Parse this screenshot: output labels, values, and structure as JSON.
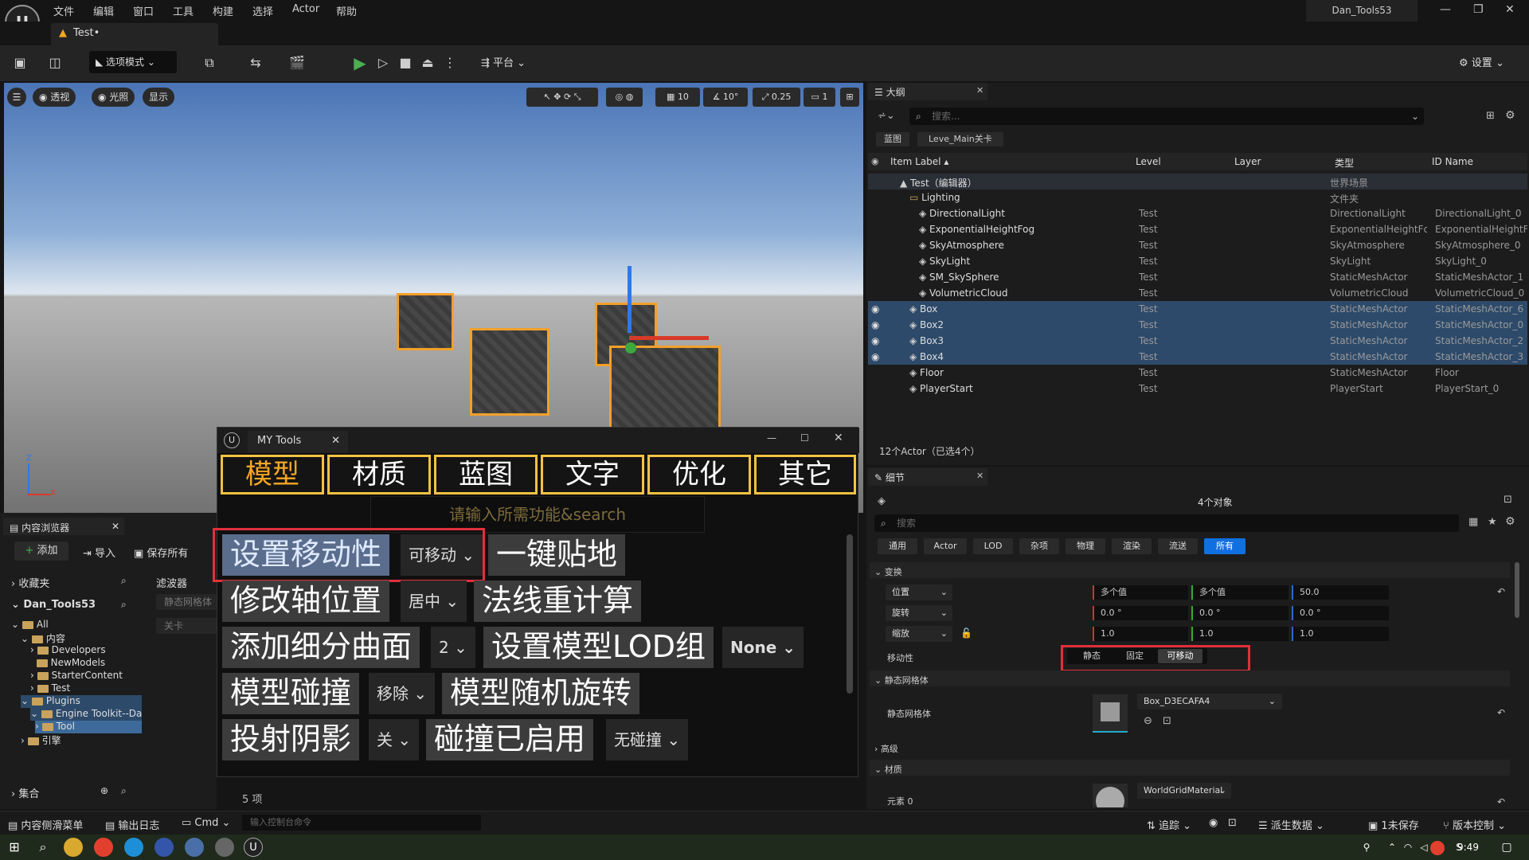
{
  "menubar": {
    "items": [
      "文件",
      "编辑",
      "窗口",
      "工具",
      "构建",
      "选择",
      "Actor",
      "帮助"
    ],
    "project_title": "Dan_Tools53",
    "logo_text": "U"
  },
  "level_tab": {
    "label": "Test•"
  },
  "toolbar": {
    "mode_label": "选项模式",
    "platform_label": "平台",
    "settings_label": "设置"
  },
  "viewport": {
    "pills": [
      "透视",
      "光照",
      "显示"
    ],
    "grid_snap": "10",
    "rotation_snap": "10°",
    "scale_snap": "0.25",
    "camera_speed": "1",
    "axis_z": "Z",
    "axis_x": "X"
  },
  "mytools": {
    "window_title": "MY Tools",
    "categories": [
      "模型",
      "材质",
      "蓝图",
      "文字",
      "优化",
      "其它"
    ],
    "search_placeholder": "请输入所需功能&search",
    "buttons": {
      "set_mobility": "设置移动性",
      "mobility_value": "可移动",
      "snap_ground": "一键贴地",
      "pivot": "修改轴位置",
      "pivot_value": "居中",
      "normals": "法线重计算",
      "subdiv": "添加细分曲面",
      "subdiv_value": "2",
      "lod_group": "设置模型LOD组",
      "lod_value": "None",
      "collision": "模型碰撞",
      "collision_value": "移除",
      "random_rot": "模型随机旋转",
      "shadow": "投射阴影",
      "shadow_value": "关",
      "collision_enabled": "碰撞已启用",
      "collision_enabled_value": "无碰撞"
    },
    "item_count": "5 项"
  },
  "content_browser": {
    "tab": "内容浏览器",
    "add": "添加",
    "import": "导入",
    "save_all": "保存所有",
    "favorites": "收藏夹",
    "project": "Dan_Tools53",
    "filters": "滤波器",
    "filter_items": [
      "静态网格体",
      "关卡"
    ],
    "tree": [
      "All",
      "内容",
      "Developers",
      "NewModels",
      "StarterContent",
      "Test",
      "Plugins",
      "Engine Toolkit--Dan",
      "Tool",
      "引擎"
    ],
    "collections": "集合"
  },
  "outliner": {
    "tab": "大纲",
    "search_placeholder": "搜索...",
    "chips": [
      "蓝图",
      "Leve_Main关卡"
    ],
    "headers": [
      "Item Label",
      "Level",
      "Layer",
      "类型",
      "ID Name"
    ],
    "rows": [
      {
        "label": "Test（编辑器）",
        "level": "",
        "type": "世界场景",
        "id": ""
      },
      {
        "label": "Lighting",
        "level": "",
        "type": "文件夹",
        "id": ""
      },
      {
        "label": "DirectionalLight",
        "level": "Test",
        "type": "DirectionalLight",
        "id": "DirectionalLight_0"
      },
      {
        "label": "ExponentialHeightFog",
        "level": "Test",
        "type": "ExponentialHeightFc",
        "id": "ExponentialHeightFc"
      },
      {
        "label": "SkyAtmosphere",
        "level": "Test",
        "type": "SkyAtmosphere",
        "id": "SkyAtmosphere_0"
      },
      {
        "label": "SkyLight",
        "level": "Test",
        "type": "SkyLight",
        "id": "SkyLight_0"
      },
      {
        "label": "SM_SkySphere",
        "level": "Test",
        "type": "StaticMeshActor",
        "id": "StaticMeshActor_1"
      },
      {
        "label": "VolumetricCloud",
        "level": "Test",
        "type": "VolumetricCloud",
        "id": "VolumetricCloud_0"
      },
      {
        "label": "Box",
        "level": "Test",
        "type": "StaticMeshActor",
        "id": "StaticMeshActor_6"
      },
      {
        "label": "Box2",
        "level": "Test",
        "type": "StaticMeshActor",
        "id": "StaticMeshActor_0"
      },
      {
        "label": "Box3",
        "level": "Test",
        "type": "StaticMeshActor",
        "id": "StaticMeshActor_2"
      },
      {
        "label": "Box4",
        "level": "Test",
        "type": "StaticMeshActor",
        "id": "StaticMeshActor_3"
      },
      {
        "label": "Floor",
        "level": "Test",
        "type": "StaticMeshActor",
        "id": "Floor"
      },
      {
        "label": "PlayerStart",
        "level": "Test",
        "type": "PlayerStart",
        "id": "PlayerStart_0"
      }
    ],
    "footer": "12个Actor（已选4个）"
  },
  "details": {
    "tab": "细节",
    "object_count": "4个对象",
    "search_placeholder": "搜索",
    "filter_tabs": [
      "通用",
      "Actor",
      "LOD",
      "杂项",
      "物理",
      "渲染",
      "流送",
      "所有"
    ],
    "transform_header": "变换",
    "location_label": "位置",
    "location": [
      "多个值",
      "多个值",
      "50.0"
    ],
    "rotation_label": "旋转",
    "rotation": [
      "0.0 °",
      "0.0 °",
      "0.0 °"
    ],
    "scale_label": "缩放",
    "scale": [
      "1.0",
      "1.0",
      "1.0"
    ],
    "mobility_label": "移动性",
    "mobility_options": [
      "静态",
      "固定",
      "可移动"
    ],
    "static_mesh_header": "静态网格体",
    "static_mesh_label": "静态网格体",
    "static_mesh_value": "Box_D3ECAFA4",
    "advanced": "高级",
    "materials_header": "材质",
    "element0": "元素 0",
    "material_value": "WorldGridMaterial"
  },
  "statusbar": {
    "drawer": "内容侧滑菜单",
    "output_log": "输出日志",
    "cmd": "Cmd",
    "console_placeholder": "输入控制台命令",
    "trace": "追踪",
    "derived_data": "派生数据",
    "unsaved": "1未保存",
    "source_control": "版本控制"
  },
  "taskbar": {
    "time": "9:49"
  }
}
